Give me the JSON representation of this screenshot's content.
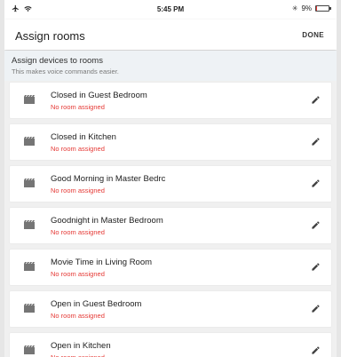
{
  "status_bar": {
    "time": "5:45 PM",
    "battery_text": "9%",
    "battery_level": 0.09,
    "icons": [
      "airplane-icon",
      "wifi-icon",
      "bluetooth-icon",
      "battery-icon"
    ]
  },
  "app_bar": {
    "title": "Assign rooms",
    "done_label": "DONE"
  },
  "section": {
    "title": "Assign devices to rooms",
    "subtitle": "This makes voice commands easier."
  },
  "colors": {
    "warning": "#e53935",
    "background": "#f0f0f0",
    "card": "#ffffff"
  },
  "devices": [
    {
      "name": "Closed in Guest Bedroom",
      "status": "No room assigned"
    },
    {
      "name": "Closed in Kitchen",
      "status": "No room assigned"
    },
    {
      "name": "Good Morning in Master Bedrc",
      "status": "No room assigned"
    },
    {
      "name": "Goodnight in Master Bedroom",
      "status": "No room assigned"
    },
    {
      "name": "Movie Time in Living Room",
      "status": "No room assigned"
    },
    {
      "name": "Open in Guest Bedroom",
      "status": "No room assigned"
    },
    {
      "name": "Open in Kitchen",
      "status": "No room assigned"
    }
  ]
}
